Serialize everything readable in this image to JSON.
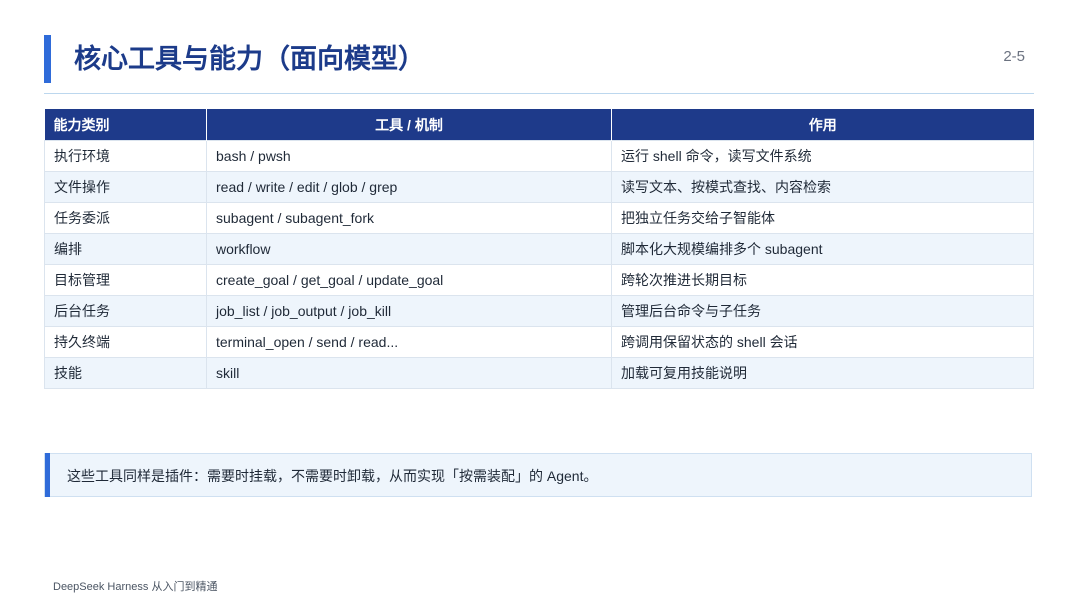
{
  "slide": {
    "title": "核心工具与能力（面向模型）",
    "page_number": "2-5",
    "accent_color": "#2f6bd9",
    "header_color": "#1e3a8a"
  },
  "table": {
    "headers": [
      "能力类别",
      "工具 / 机制",
      "作用"
    ],
    "rows": [
      [
        "执行环境",
        "bash / pwsh",
        "运行 shell 命令，读写文件系统"
      ],
      [
        "文件操作",
        "read / write / edit / glob / grep",
        "读写文本、按模式查找、内容检索"
      ],
      [
        "任务委派",
        "subagent / subagent_fork",
        "把独立任务交给子智能体"
      ],
      [
        "编排",
        "workflow",
        "脚本化大规模编排多个 subagent"
      ],
      [
        "目标管理",
        "create_goal / get_goal / update_goal",
        "跨轮次推进长期目标"
      ],
      [
        "后台任务",
        "job_list / job_output / job_kill",
        "管理后台命令与子任务"
      ],
      [
        "持久终端",
        "terminal_open / send / read...",
        "跨调用保留状态的 shell 会话"
      ],
      [
        "技能",
        "skill",
        "加载可复用技能说明"
      ]
    ]
  },
  "note": {
    "text": "这些工具同样是插件：需要时挂载，不需要时卸载，从而实现「按需装配」的 Agent。"
  },
  "footer": {
    "text": "DeepSeek Harness 从入门到精通"
  }
}
